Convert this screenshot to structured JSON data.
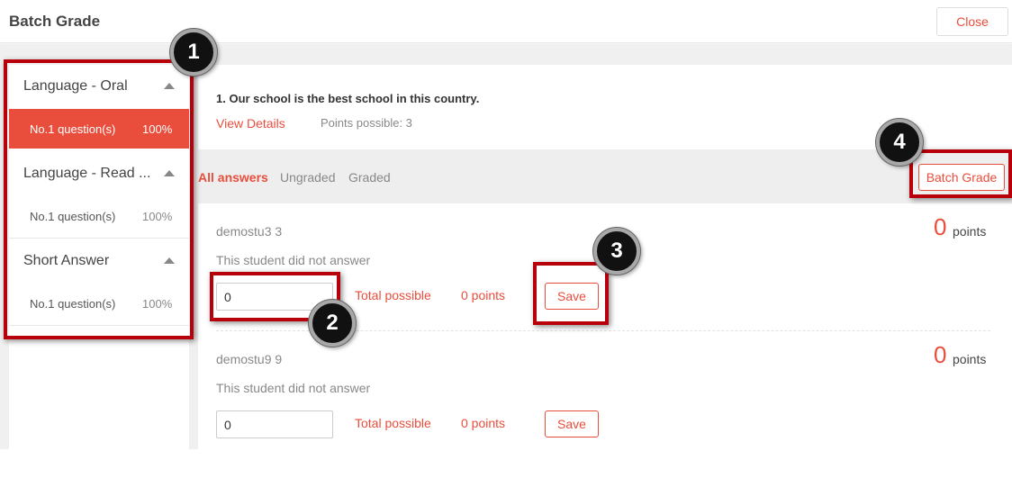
{
  "header": {
    "title": "Batch Grade",
    "close_label": "Close"
  },
  "sidebar": {
    "sections": [
      {
        "title": "Language - Oral",
        "item": {
          "label": "No.1 question(s)",
          "percent": "100%"
        }
      },
      {
        "title": "Language - Read ...",
        "item": {
          "label": "No.1 question(s)",
          "percent": "100%"
        }
      },
      {
        "title": "Short Answer",
        "item": {
          "label": "No.1 question(s)",
          "percent": "100%"
        }
      }
    ]
  },
  "question": {
    "text": "1. Our school is the best school in this country.",
    "view_details": "View Details",
    "points_possible": "Points possible: 3"
  },
  "filters": {
    "all": "All answers",
    "ungraded": "Ungraded",
    "graded": "Graded",
    "batch_grade_label": "Batch Grade"
  },
  "answers": [
    {
      "student": "demostu3  3",
      "score": "0",
      "points_label": "points",
      "note": "This student did not answer",
      "input_value": "0",
      "total_possible_label": "Total possible",
      "total_points": "0 points",
      "save_label": "Save"
    },
    {
      "student": "demostu9  9",
      "score": "0",
      "points_label": "points",
      "note": "This student did not answer",
      "input_value": "0",
      "total_possible_label": "Total possible",
      "total_points": "0 points",
      "save_label": "Save"
    }
  ],
  "callouts": [
    "1",
    "2",
    "3",
    "4"
  ],
  "colors": {
    "accent": "#e94e3c",
    "highlight_border": "#b8000a",
    "badge_fill": "#111111"
  }
}
